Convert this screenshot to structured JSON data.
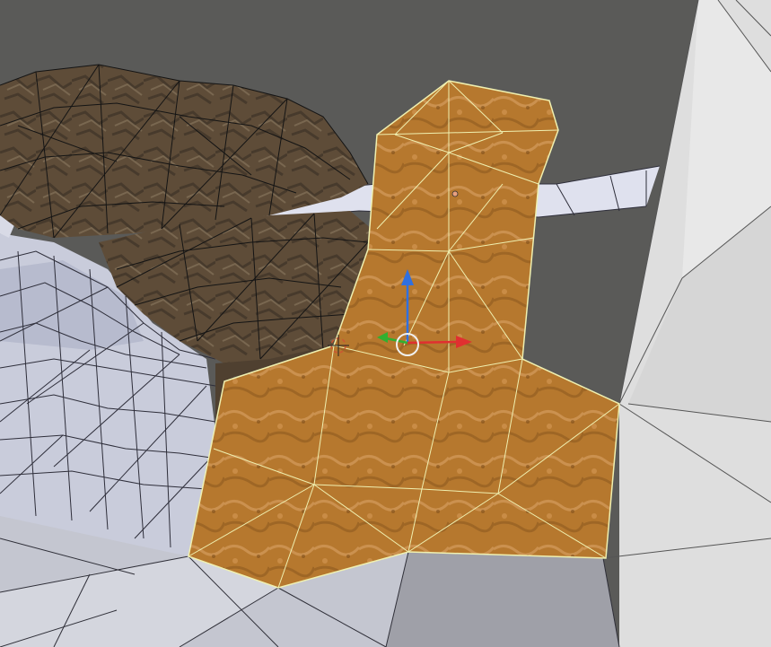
{
  "viewport": {
    "background_color": "#5a5a58",
    "mode": "edit-mode",
    "selection_count": "1 object"
  },
  "colors": {
    "selected_face_fill": "#b87a2f",
    "selected_edge": "#f0f0b0",
    "terrain_fill": "#c9ccd9",
    "terrain_wire": "#2e2e3a",
    "rock_fill": "#5c4b36",
    "wall_fill": "#dcdcdc",
    "floor_dark": "#9fa0a8",
    "gizmo_x": "#e03030",
    "gizmo_y": "#30b030",
    "gizmo_z": "#3070e0",
    "cursor_color": "#cc5533"
  },
  "icons": {
    "gizmo_x_axis": "arrow-right-icon",
    "gizmo_y_axis": "arrow-left-icon",
    "gizmo_z_axis": "arrow-up-icon",
    "gizmo_center": "circle-icon",
    "cursor_3d": "crosshair-icon"
  }
}
